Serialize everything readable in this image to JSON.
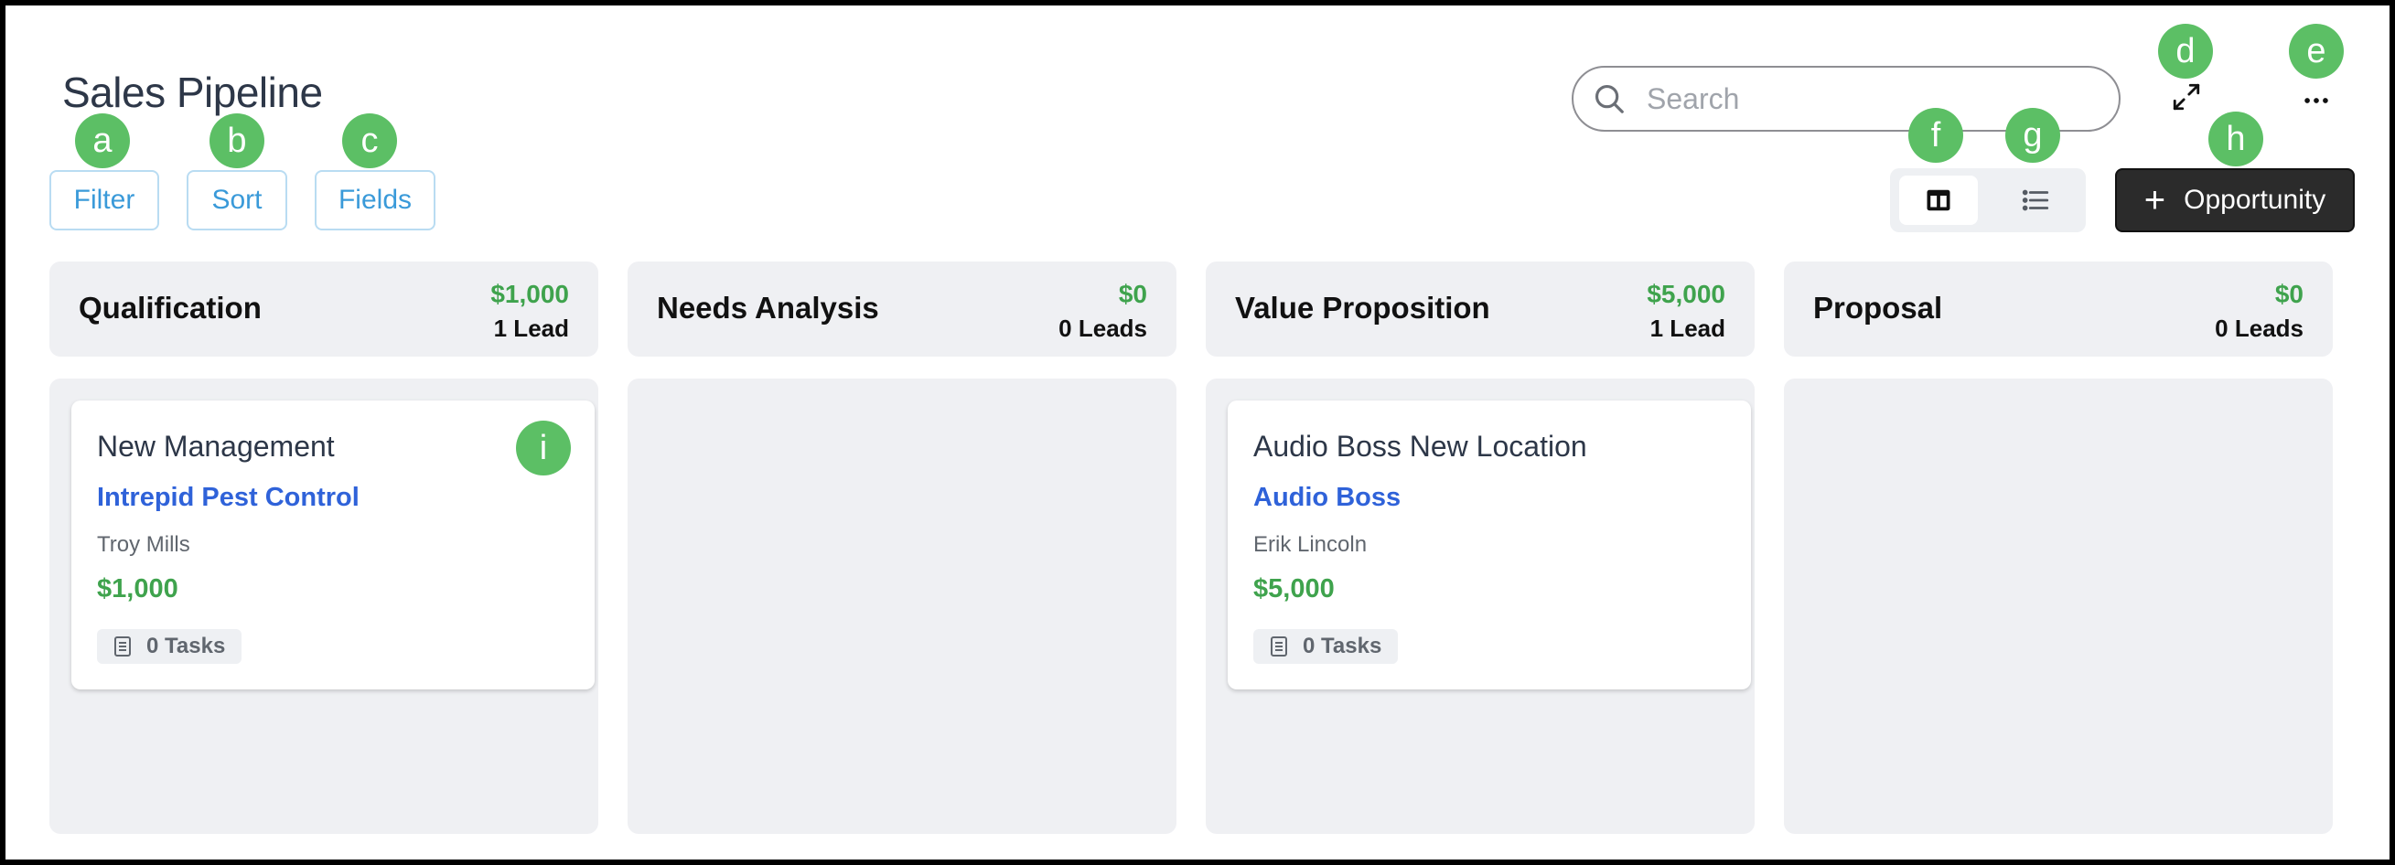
{
  "header": {
    "title": "Sales Pipeline"
  },
  "search": {
    "placeholder": "Search",
    "value": ""
  },
  "toolbar": {
    "filter_label": "Filter",
    "sort_label": "Sort",
    "fields_label": "Fields",
    "add_label": "Opportunity",
    "add_icon": "plus-icon",
    "expand_icon": "expand-icon",
    "more_icon": "more-horizontal-icon",
    "board_view_icon": "board-view-icon",
    "list_view_icon": "list-view-icon",
    "active_view": "board"
  },
  "markers": [
    "a",
    "b",
    "c",
    "d",
    "e",
    "f",
    "g",
    "h",
    "i"
  ],
  "columns": [
    {
      "name": "Qualification",
      "amount": "$1,000",
      "leads": "1 Lead",
      "cards": [
        {
          "title": "New Management",
          "company": "Intrepid Pest Control",
          "contact": "Troy Mills",
          "value": "$1,000",
          "tasks": "0 Tasks"
        }
      ]
    },
    {
      "name": "Needs Analysis",
      "amount": "$0",
      "leads": "0 Leads",
      "cards": []
    },
    {
      "name": "Value Proposition",
      "amount": "$5,000",
      "leads": "1 Lead",
      "cards": [
        {
          "title": "Audio Boss New Location",
          "company": "Audio Boss",
          "contact": "Erik Lincoln",
          "value": "$5,000",
          "tasks": "0 Tasks"
        }
      ]
    },
    {
      "name": "Proposal",
      "amount": "$0",
      "leads": "0 Leads",
      "cards": []
    }
  ],
  "colors": {
    "accent_green": "#3fa34d",
    "link_blue": "#2f62d9",
    "button_dark": "#2b2b2b",
    "marker_green": "#5cbf65"
  }
}
